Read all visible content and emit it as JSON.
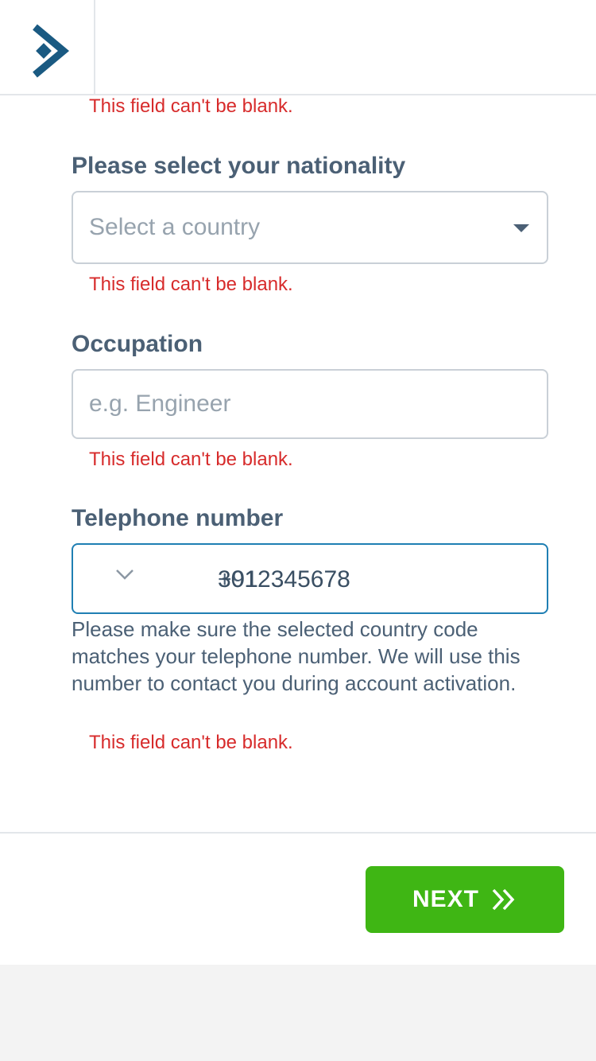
{
  "header": {
    "logo_icon": "diamond-arrow-logo-icon"
  },
  "nationality": {
    "label": "Please select your nationality",
    "placeholder": "Select a country",
    "error": "This field can't be blank."
  },
  "previous_field": {
    "error": "This field can't be blank."
  },
  "occupation": {
    "label": "Occupation",
    "placeholder": "e.g. Engineer",
    "error": "This field can't be blank."
  },
  "telephone": {
    "label": "Telephone number",
    "country_code": "+91",
    "number": "3012345678",
    "helper": "Please make sure the selected country code matches your telephone number. We will use this number to contact you during account activation.",
    "error": "This field can't be blank."
  },
  "actions": {
    "next_label": "NEXT",
    "next_icon": "double-chevron-right-icon"
  },
  "colors": {
    "accent": "#3fb614",
    "error": "#d72b2b",
    "brand": "#1a5a82",
    "focus": "#1f7fb3"
  }
}
